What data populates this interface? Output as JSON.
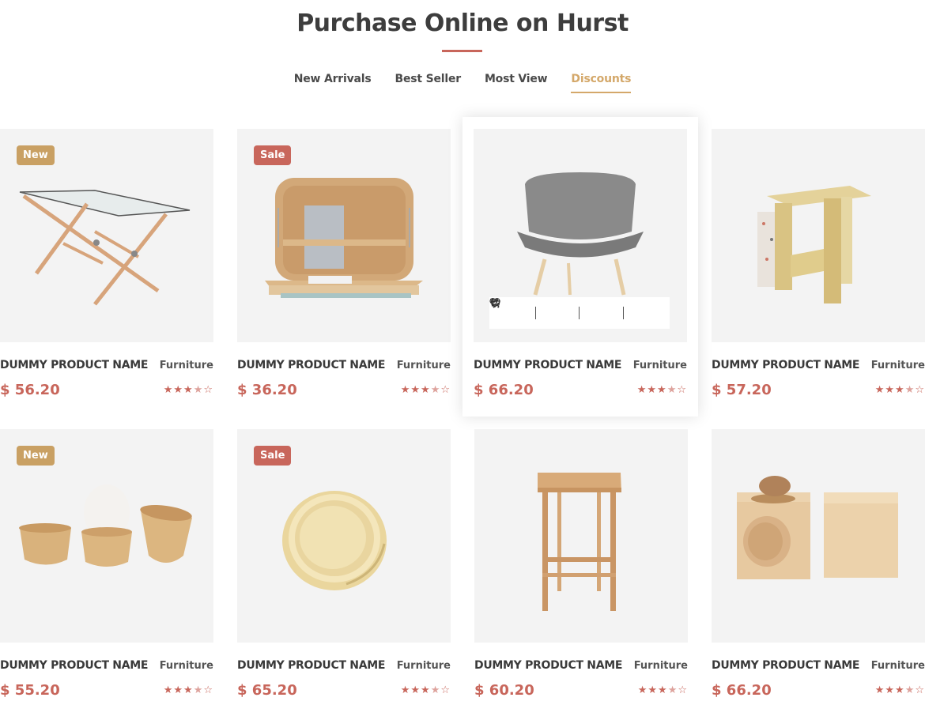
{
  "header": {
    "title": "Purchase Online on Hurst",
    "tabs": [
      "New Arrivals",
      "Best Seller",
      "Most View",
      "Discounts"
    ],
    "active_tab": "Discounts"
  },
  "colors": {
    "accent": "#c8665b",
    "tab_active": "#d4a86a",
    "badge_new": "#c9a063",
    "badge_sale": "#c8665b"
  },
  "products": [
    {
      "name": "DUMMY PRODUCT NAME",
      "category": "Furniture",
      "price": "$ 56.20",
      "badge": "New",
      "rating": 3.5,
      "image": "glass-table"
    },
    {
      "name": "DUMMY PRODUCT NAME",
      "category": "Furniture",
      "price": "$ 36.20",
      "badge": "Sale",
      "rating": 3.5,
      "image": "wall-desk"
    },
    {
      "name": "DUMMY PRODUCT NAME",
      "category": "Furniture",
      "price": "$ 66.20",
      "badge": "",
      "rating": 3.5,
      "image": "grey-chair"
    },
    {
      "name": "DUMMY PRODUCT NAME",
      "category": "Furniture",
      "price": "$ 57.20",
      "badge": "",
      "rating": 3.5,
      "image": "plywood-stool"
    },
    {
      "name": "DUMMY PRODUCT NAME",
      "category": "Furniture",
      "price": "$ 55.20",
      "badge": "New",
      "rating": 3.5,
      "image": "wooden-cups"
    },
    {
      "name": "DUMMY PRODUCT NAME",
      "category": "Furniture",
      "price": "$ 65.20",
      "badge": "Sale",
      "rating": 3.5,
      "image": "brass-bowl"
    },
    {
      "name": "DUMMY PRODUCT NAME",
      "category": "Furniture",
      "price": "$ 60.20",
      "badge": "",
      "rating": 3.5,
      "image": "bar-stool"
    },
    {
      "name": "DUMMY PRODUCT NAME",
      "category": "Furniture",
      "price": "$ 66.20",
      "badge": "",
      "rating": 3.5,
      "image": "wood-blocks"
    }
  ],
  "quick_actions": [
    "heart-icon",
    "zoom-icon",
    "compare-icon",
    "cart-icon"
  ]
}
